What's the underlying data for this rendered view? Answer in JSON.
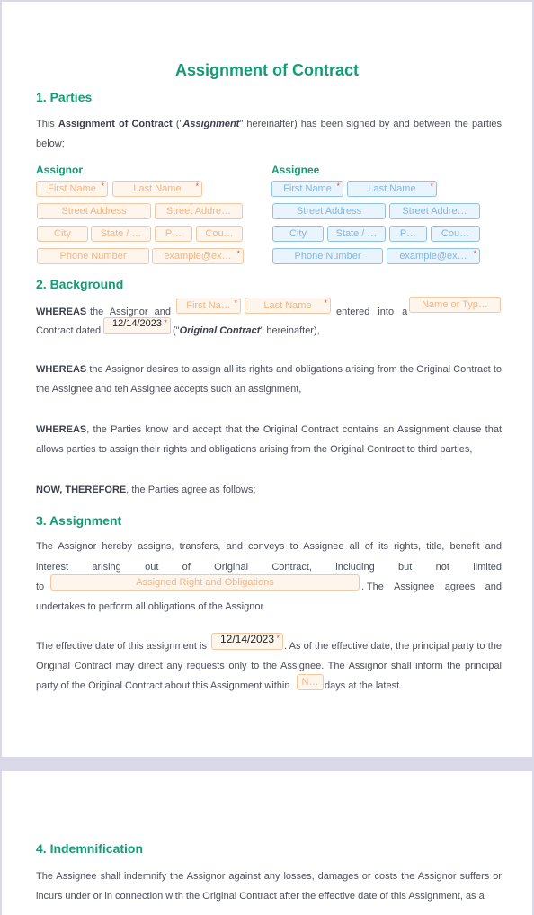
{
  "document": {
    "title": "Assignment of Contract",
    "colors": {
      "heading": "#139b76",
      "assignor_field": "#f6c79c",
      "assignee_field": "#8cc3ea",
      "required": "#e8463a"
    }
  },
  "section1": {
    "heading": "1. Parties",
    "intro_pre": "This ",
    "intro_bold": "Assignment of Contract",
    "intro_mid": " (\"",
    "intro_italic": "Assignment",
    "intro_post": "\" hereinafter) has been signed by and between the parties below;",
    "assignor": {
      "label": "Assignor",
      "first_name": "First Name",
      "last_name": "Last Name",
      "street_address": "Street Address",
      "street_address_2": "Street Addre…",
      "city": "City",
      "state": "State / …",
      "postal": "P…",
      "country": "Cou…",
      "phone": "Phone Number",
      "email": "example@ex…"
    },
    "assignee": {
      "label": "Assignee",
      "first_name": "First Name",
      "last_name": "Last Name",
      "street_address": "Street Address",
      "street_address_2": "Street Addre…",
      "city": "City",
      "state": "State / …",
      "postal": "P…",
      "country": "Cou…",
      "phone": "Phone Number",
      "email": "example@ex…"
    }
  },
  "section2": {
    "heading": "2. Background",
    "whereas1_bold": "WHEREAS",
    "whereas1_a": "the Assignor and",
    "party_first": "First Na…",
    "party_last": "Last Name",
    "whereas1_b": "entered into a",
    "contract_type": "Name or Typ…",
    "contract_dated": "Contract dated",
    "contract_date": "12/14/2023",
    "orig_pre": "(\"",
    "orig_italic": "Original Contract",
    "orig_post": "\" hereinafter),",
    "whereas2_bold": "WHEREAS",
    "whereas2": " the Assignor desires to assign all its rights and obligations arising from the Original Contract to the Assignee and teh Assignee accepts such an assignment,",
    "whereas3_bold": "WHEREAS",
    "whereas3": ", the Parties know and accept that the Original Contract contains an Assignment clause that allows parties to assign their rights and obligations arising from the Original Contract to third parties,",
    "now_bold": "NOW, THEREFORE",
    "now": ", the Parties agree as follows;"
  },
  "section3": {
    "heading": "3. Assignment",
    "para1_line1": "The Assignor hereby assigns, transfers, and conveys to Assignee all of its rights, title, benefit and",
    "para1_line2_words": [
      "interest",
      "arising",
      "out",
      "of",
      "Original",
      "Contract,",
      "including",
      "but",
      "not",
      "limited"
    ],
    "para1_to": "to",
    "rights_placeholder": "Assigned Right and Obligations",
    "para1_line3_words": [
      ". The",
      "Assignee",
      "agrees",
      "and"
    ],
    "para1_line4": "undertakes to perform all obligations of the Assignor.",
    "para2_pre": "The effective date of this assignment is",
    "effective_date": "12/14/2023",
    "para2_post": ". As of the effective date, the principal party to the",
    "para2_line2": "Original Contract may direct any requests only to the Assignee. The Assignor shall inform the principal",
    "para2_line3_pre": "party of the Original Contract about this Assignment within",
    "days_placeholder": "N…",
    "para2_line3_post": "days at the latest."
  },
  "section4": {
    "heading": "4. Indemnification",
    "para": "The Assignee shall indemnify the Assignor against any losses, damages or costs the Assignor suffers or incurs under or in connection with the Original Contract after the effective date of this Assignment, as a"
  }
}
